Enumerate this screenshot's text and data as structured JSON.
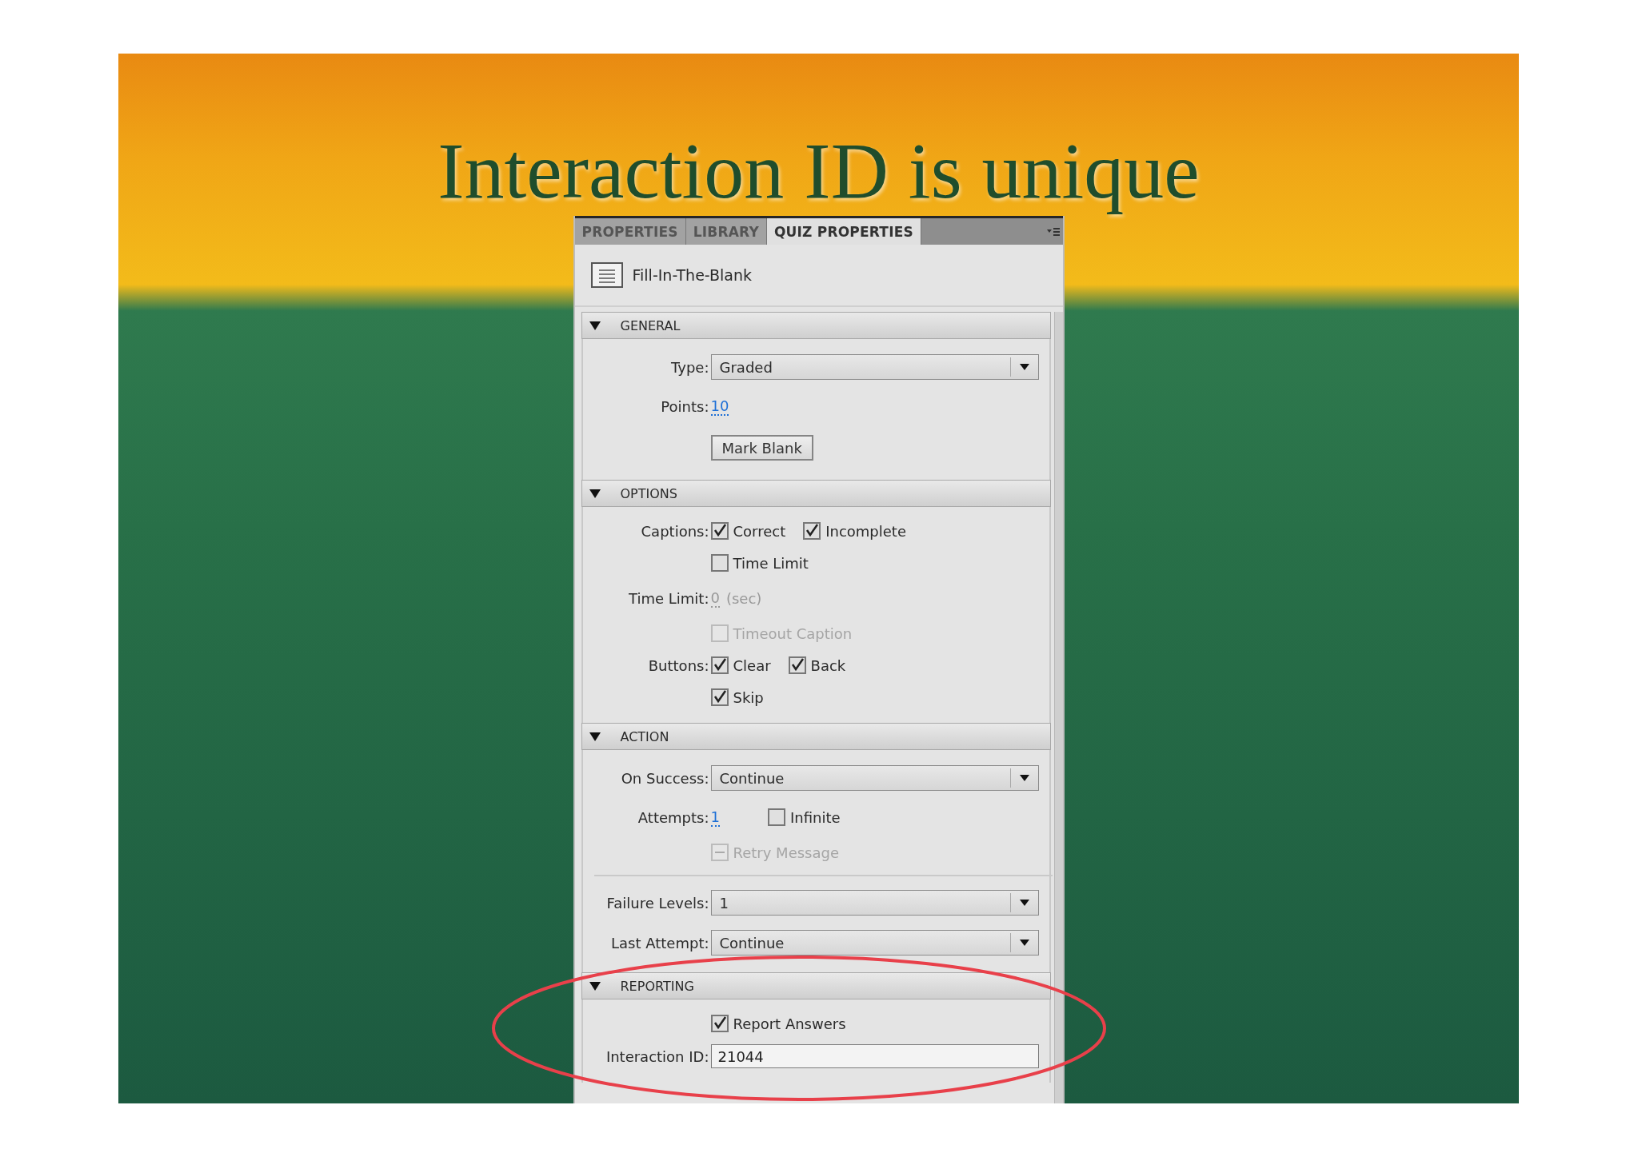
{
  "slide_title": "Interaction ID is unique",
  "panel": {
    "tabs": [
      {
        "label": "PROPERTIES",
        "selected": false
      },
      {
        "label": "LIBRARY",
        "selected": false
      },
      {
        "label": "QUIZ PROPERTIES",
        "selected": true
      }
    ],
    "item_type": "Fill-In-The-Blank",
    "sections": [
      {
        "title": "GENERAL",
        "expanded": true,
        "rows": [
          {
            "kind": "dropdown",
            "label": "Type:",
            "value": "Graded"
          },
          {
            "kind": "number",
            "label": "Points:",
            "value": "10",
            "disabled": false
          },
          {
            "kind": "button",
            "text": "Mark Blank"
          }
        ]
      },
      {
        "title": "OPTIONS",
        "expanded": true,
        "rows": [
          {
            "kind": "checkboxes",
            "label": "Captions:",
            "checkboxes": [
              {
                "text": "Correct",
                "checked": true,
                "indeterminate": false,
                "disabled": false
              },
              {
                "text": "Incomplete",
                "checked": true,
                "indeterminate": false,
                "disabled": false
              }
            ]
          },
          {
            "kind": "checkboxes",
            "checkboxes": [
              {
                "text": "Time Limit",
                "checked": false,
                "indeterminate": false,
                "disabled": false
              }
            ]
          },
          {
            "kind": "number",
            "label": "Time Limit:",
            "value": "0",
            "unit": "(sec)",
            "disabled": true
          },
          {
            "kind": "checkboxes",
            "checkboxes": [
              {
                "text": "Timeout Caption",
                "checked": false,
                "indeterminate": false,
                "disabled": true
              }
            ]
          },
          {
            "kind": "checkboxes",
            "label": "Buttons:",
            "checkboxes": [
              {
                "text": "Clear",
                "checked": true,
                "indeterminate": false,
                "disabled": false
              },
              {
                "text": "Back",
                "checked": true,
                "indeterminate": false,
                "disabled": false
              }
            ]
          },
          {
            "kind": "checkboxes",
            "checkboxes": [
              {
                "text": "Skip",
                "checked": true,
                "indeterminate": false,
                "disabled": false
              }
            ]
          }
        ]
      },
      {
        "title": "ACTION",
        "expanded": true,
        "rows": [
          {
            "kind": "dropdown",
            "label": "On Success:",
            "value": "Continue"
          },
          {
            "kind": "number",
            "label": "Attempts:",
            "value": "1",
            "disabled": false,
            "checkbox": {
              "text": "Infinite",
              "checked": false,
              "indeterminate": false,
              "disabled": false
            }
          },
          {
            "kind": "checkboxes",
            "checkboxes": [
              {
                "text": "Retry Message",
                "checked": false,
                "indeterminate": true,
                "disabled": true
              }
            ]
          },
          {
            "kind": "divider"
          },
          {
            "kind": "dropdown",
            "label": "Failure Levels:",
            "value": "1"
          },
          {
            "kind": "dropdown",
            "label": "Last Attempt:",
            "value": "Continue"
          }
        ]
      },
      {
        "title": "REPORTING",
        "expanded": true,
        "rows": [
          {
            "kind": "checkboxes",
            "checkboxes": [
              {
                "text": "Report Answers",
                "checked": true,
                "indeterminate": false,
                "disabled": false
              }
            ]
          },
          {
            "kind": "text_field",
            "label": "Interaction ID:",
            "value": "21044"
          }
        ]
      }
    ]
  }
}
